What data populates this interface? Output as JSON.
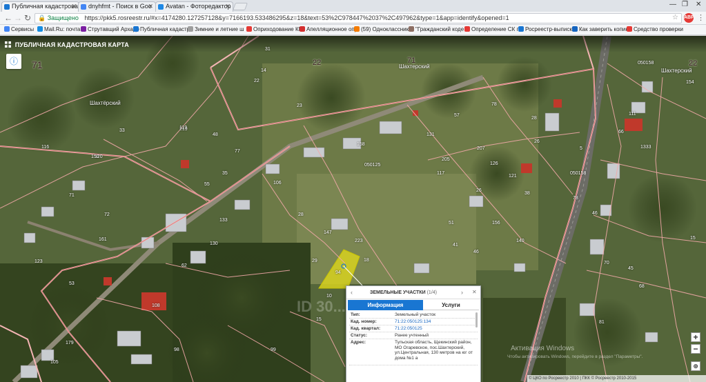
{
  "browser": {
    "tabs": [
      {
        "title": "Публичная кадастровая",
        "color": "#1976d2"
      },
      {
        "title": "dnyhfmt - Поиск в Goo",
        "color": "#4285f4"
      },
      {
        "title": "Avatan - Фоторедактор",
        "color": "#1e88e5"
      }
    ],
    "url_secure_label": "Защищено",
    "url": "https://pkk5.rosreestr.ru/#x=4174280.127257128&y=7166193.533486295&z=18&text=53%2C978447%2037%2C497962&type=1&app=identify&opened=1",
    "bookmarks": [
      {
        "label": "Сервисы",
        "color": "#4285f4"
      },
      {
        "label": "Mail.Ru: почта",
        "color": "#168de2"
      },
      {
        "label": "Струтавщий Архаде",
        "color": "#7b1fa2"
      },
      {
        "label": "Публичная кадастр",
        "color": "#1976d2"
      },
      {
        "label": "Зимние и летние ш",
        "color": "#9e9e9e"
      },
      {
        "label": "Оприходование КМ",
        "color": "#e53935"
      },
      {
        "label": "Апелляционное опр",
        "color": "#d32f2f"
      },
      {
        "label": "(59) Одноклассники",
        "color": "#f57c00"
      },
      {
        "label": "\"Гражданский коде",
        "color": "#8d6e63"
      },
      {
        "label": "Определение СК по",
        "color": "#e53935"
      },
      {
        "label": "Росреестр-выписка",
        "color": "#1976d2"
      },
      {
        "label": "Как заверить копию",
        "color": "#1565c0"
      },
      {
        "label": "Средство проверки",
        "color": "#e53935"
      }
    ]
  },
  "map": {
    "title": "ПУБЛИЧНАЯ КАДАСТРОВАЯ КАРТА",
    "region_label": "71",
    "locality_labels": [
      "Шахтёрский",
      "Шахтерский",
      "Шахтерский"
    ],
    "district_labels": [
      "71",
      "22",
      "22"
    ],
    "quarter_labels": [
      "050125",
      "050158"
    ],
    "parcel_numbers": [
      "31",
      "14",
      "22",
      "23",
      "33",
      "219",
      "48",
      "77",
      "106",
      "35",
      "55",
      "71",
      "72",
      "28",
      "119",
      "120",
      "205",
      "131",
      "126",
      "121",
      "158",
      "117",
      "207",
      "147",
      "223",
      "29",
      "94",
      "10",
      "15",
      "18",
      "41",
      "156",
      "46",
      "51",
      "140",
      "38",
      "26",
      "123",
      "161",
      "53",
      "108",
      "130",
      "62",
      "133",
      "150",
      "116",
      "28",
      "78",
      "57",
      "26",
      "111",
      "66",
      "1333",
      "46",
      "45",
      "15",
      "68",
      "81",
      "70",
      "154",
      "5",
      "78",
      "179",
      "105",
      "98",
      "99",
      "141"
    ],
    "zoom_in": "+",
    "zoom_out": "−",
    "copyright": "© ЦКО по Росреестр 2010 | ПКК © Росреестр 2010-2015"
  },
  "popup": {
    "header": "ЗЕМЕЛЬНЫЕ УЧАСТКИ",
    "pager": "(1/4)",
    "tab_info": "Информация",
    "tab_services": "Услуги",
    "fields": [
      {
        "key": "Тип:",
        "value": "Земельный участок"
      },
      {
        "key": "Кад. номер:",
        "value": "71:22:050125:134",
        "link": true
      },
      {
        "key": "Кад. квартал:",
        "value": "71:22:050125",
        "link": true
      },
      {
        "key": "Статус:",
        "value": "Ранее учтенный"
      },
      {
        "key": "Адрес:",
        "value": "Тульская область, Щекинский район, МО Огаревское, пос.Шахтерский, ул.Центральная, 130 метров на юг от дома №1 а"
      }
    ]
  },
  "overlay": {
    "watermark": "Активация Windows",
    "watermark_sub": "Чтобы активировать Windows, перейдите в раздел \"Параметры\"."
  }
}
